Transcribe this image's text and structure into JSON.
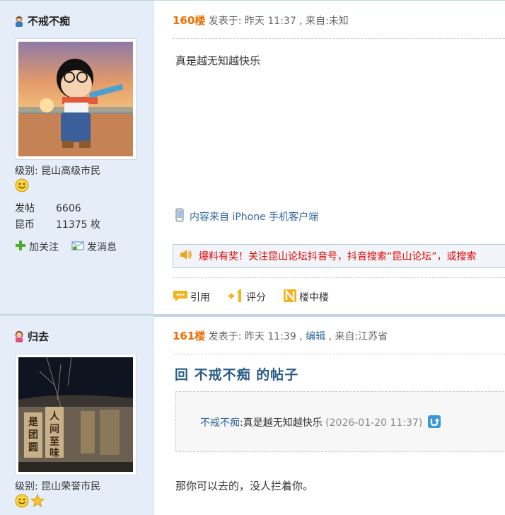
{
  "posts": [
    {
      "username": "不戒不痴",
      "level_label": "级别:",
      "level_value": "昆山高级市民",
      "stats": [
        {
          "key": "发帖",
          "value": "6606"
        },
        {
          "key": "昆币",
          "value": "11375 枚"
        }
      ],
      "actions": {
        "follow": "加关注",
        "message": "发消息"
      },
      "floor": "160楼",
      "posted": "发表于: 昨天 11:37 ,",
      "source": "来自:未知",
      "content": "真是越无知越快乐",
      "client_note": "内容来自 iPhone 手机客户端",
      "notice": "爆料有奖！关注昆山论坛抖音号，抖音搜索“昆山论坛”，或搜索",
      "ops": {
        "quote": "引用",
        "rate": "评分",
        "sub": "楼中楼"
      }
    },
    {
      "username": "归去",
      "level_label": "级别:",
      "level_value": "昆山荣誉市民",
      "floor": "161楼",
      "posted": "发表于: 昨天 11:39 ,",
      "edit": "编辑",
      "source": ", 来自:江苏省",
      "reply_title": "回 不戒不痴 的帖子",
      "quote_author": "不戒不痴",
      "quote_text": ":真是越无知越快乐",
      "quote_time": " (2026-01-20 11:37)",
      "content": "那你可以去的，没人拦着你。"
    }
  ],
  "colors": {
    "floor": "#f26c00",
    "link": "#336699",
    "sidebar": "#e5eef8",
    "notice_text": "#e60000"
  }
}
